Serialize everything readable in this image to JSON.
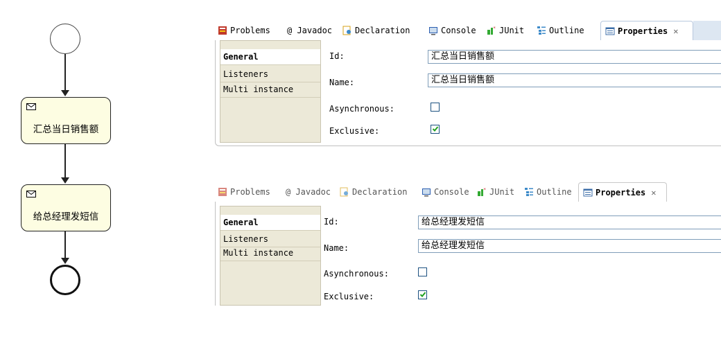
{
  "diagram": {
    "task1_label": "汇总当日销售额",
    "task2_label": "给总经理发短信"
  },
  "panel1": {
    "tabs": [
      "Problems",
      "@ Javadoc",
      "Declaration",
      "Console",
      "JUnit",
      "Outline",
      "Properties"
    ],
    "close_glyph": "✕",
    "sidebar": [
      "General",
      "Listeners",
      "Multi instance"
    ],
    "fields": {
      "id_label": "Id:",
      "id_value": "汇总当日销售额",
      "name_label": "Name:",
      "name_value": "汇总当日销售额",
      "async_label": "Asynchronous:",
      "async_checked": false,
      "exclusive_label": "Exclusive:",
      "exclusive_checked": true
    }
  },
  "panel2": {
    "tabs": [
      "Problems",
      "@ Javadoc",
      "Declaration",
      "Console",
      "JUnit",
      "Outline",
      "Properties"
    ],
    "close_glyph": "✕",
    "sidebar": [
      "General",
      "Listeners",
      "Multi instance"
    ],
    "fields": {
      "id_label": "Id:",
      "id_value": "给总经理发短信",
      "name_label": "Name:",
      "name_value": "给总经理发短信",
      "async_label": "Asynchronous:",
      "async_checked": false,
      "exclusive_label": "Exclusive:",
      "exclusive_checked": true
    }
  },
  "colors": {
    "task_fill": "#fdfde2",
    "sidebar_bg": "#ece9d8",
    "input_border": "#7f9db9",
    "checkbox_border": "#1c5180",
    "check_green": "#21a121"
  },
  "icons": [
    "problems-icon",
    "console-icon",
    "junit-icon",
    "outline-icon",
    "properties-icon",
    "declaration-icon",
    "mail-icon",
    "close-icon"
  ]
}
